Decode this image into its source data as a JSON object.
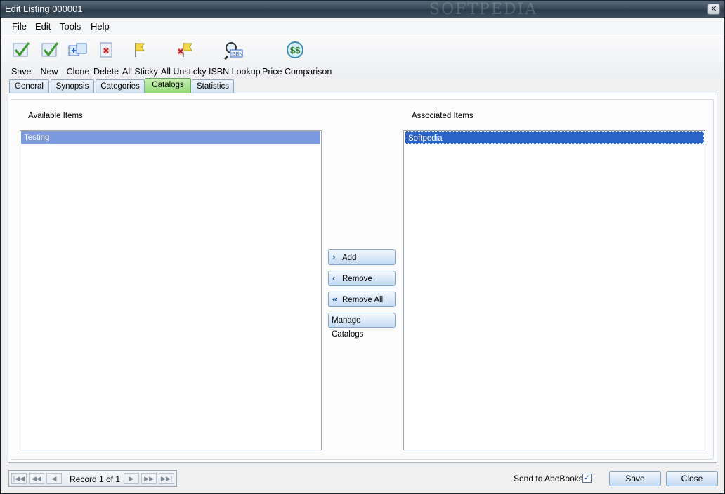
{
  "window": {
    "title": "Edit Listing 000001",
    "watermark": "SOFTPEDIA"
  },
  "menu": [
    "File",
    "Edit",
    "Tools",
    "Help"
  ],
  "toolbar": [
    {
      "label": "Save",
      "icon": "save-check-icon"
    },
    {
      "label": "New",
      "icon": "new-check-icon"
    },
    {
      "label": "Clone",
      "icon": "clone-icon"
    },
    {
      "label": "Delete",
      "icon": "delete-icon"
    },
    {
      "label": "All Sticky",
      "icon": "flag-icon"
    },
    {
      "label": "All Unsticky",
      "icon": "unsticky-icon"
    },
    {
      "label": "ISBN Lookup",
      "icon": "isbn-magnifier-icon"
    },
    {
      "label": "Price Comparison",
      "icon": "price-comparison-icon"
    }
  ],
  "tabs": [
    "General",
    "Synopsis",
    "Categories",
    "Catalogs",
    "Statistics"
  ],
  "active_tab": "Catalogs",
  "available": {
    "label": "Available Items",
    "items": [
      "Testing"
    ]
  },
  "associated": {
    "label": "Associated Items",
    "items": [
      "Softpedia"
    ]
  },
  "buttons": {
    "add": "Add",
    "remove": "Remove",
    "remove_all": "Remove All",
    "manage": "Manage Catalogs"
  },
  "status": {
    "record": "Record 1 of 1",
    "send_label": "Send to AbeBooks:",
    "send_checked": true,
    "save": "Save",
    "close": "Close"
  },
  "colors": {
    "accent": "#2b63c8",
    "tab_active": "#8fd875"
  }
}
